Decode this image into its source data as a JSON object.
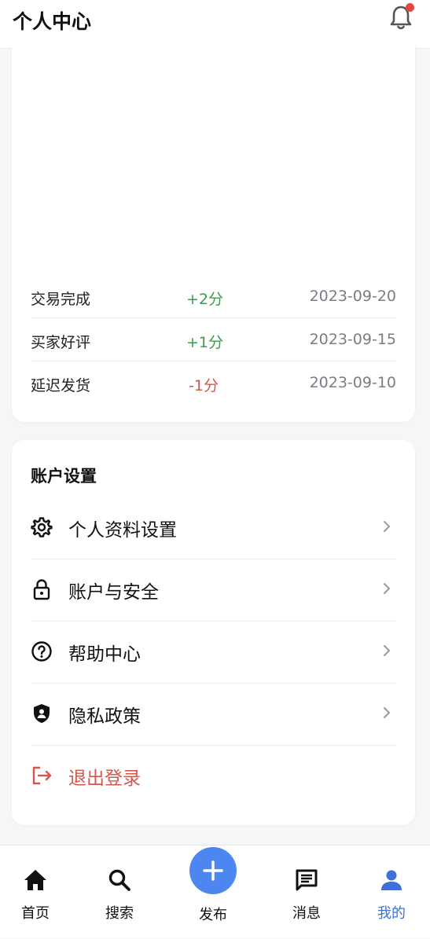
{
  "header": {
    "title": "个人中心",
    "notification_dot": true
  },
  "credit_records": [
    {
      "label": "交易完成",
      "score": "+2分",
      "type": "pos",
      "date": "2023-09-20"
    },
    {
      "label": "买家好评",
      "score": "+1分",
      "type": "pos",
      "date": "2023-09-15"
    },
    {
      "label": "延迟发货",
      "score": "-1分",
      "type": "neg",
      "date": "2023-09-10"
    }
  ],
  "settings": {
    "title": "账户设置",
    "items": [
      {
        "label": "个人资料设置",
        "icon": "gear-icon"
      },
      {
        "label": "账户与安全",
        "icon": "lock-icon"
      },
      {
        "label": "帮助中心",
        "icon": "help-circle-icon"
      },
      {
        "label": "隐私政策",
        "icon": "shield-icon"
      },
      {
        "label": "退出登录",
        "icon": "logout-icon"
      }
    ]
  },
  "tabbar": {
    "home": "首页",
    "search": "搜索",
    "publish": "发布",
    "messages": "消息",
    "mine": "我的",
    "active": "mine"
  },
  "colors": {
    "accent": "#4d86f0",
    "active_tab": "#3f6fd8",
    "positive": "#3a9b4b",
    "negative": "#d2574c",
    "badge": "#e04a3f"
  }
}
